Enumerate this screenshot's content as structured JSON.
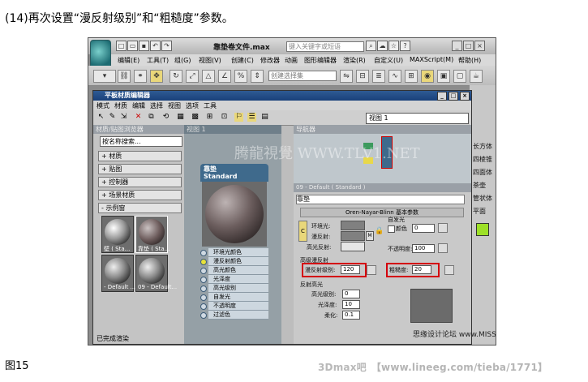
{
  "caption": "(14)再次设置“漫反射级别”和“粗糙度”参数。",
  "figure_label": "图15",
  "footer": {
    "brand": "3Dmax吧",
    "url": "【www.lineeg.com/tieba/1771】"
  },
  "max_window": {
    "doc_title": "靠垫卷文件.max",
    "search_placeholder": "键入关键字或短语",
    "menus": [
      "编辑(E)",
      "工具(T)",
      "组(G)",
      "视图(V)",
      "创建(C)",
      "修改器",
      "动画",
      "图形编辑器",
      "渲染(R)",
      "自定义(U)",
      "MAXScript(M)",
      "帮助(H)"
    ],
    "selection_set": "创建选择集",
    "right_panel": [
      "长方体",
      "四棱锥",
      "四面体",
      "茶壶",
      "管状体",
      "平面"
    ]
  },
  "slate": {
    "title": "平板材质编辑器",
    "menus": [
      "模式",
      "材质",
      "编辑",
      "选择",
      "视图",
      "选项",
      "工具"
    ],
    "view_select": "视图 1",
    "browser": {
      "header": "材质/贴图浏览器",
      "search": "按名称搜索...",
      "categories": [
        "+ 材质",
        "+ 贴图",
        "+ 控制器",
        "+ 场景材质",
        "- 示例窗"
      ],
      "thumbs": [
        "壁 ( Sta...",
        "靠垫 ( Sta...",
        "- Default ...",
        "09 - Default..."
      ]
    },
    "view_tab": "视图 1",
    "node": {
      "name": "靠垫",
      "type": "Standard",
      "slots": [
        "环境光颜色",
        "漫反射颜色",
        "高光颜色",
        "光泽度",
        "高光级别",
        "自发光",
        "不透明度",
        "过滤色"
      ]
    },
    "navigator": "导航器",
    "params": {
      "header": "09 - Default ( Standard )",
      "name": "靠垫",
      "rollout": "Oren-Nayar-Blinn 基本参数",
      "ambient": "环境光:",
      "diffuse": "漫反射:",
      "specular": "高光反射:",
      "self_illum_group": "自发光",
      "color_label": "颜色",
      "color_value": "0",
      "opacity_label": "不透明度:",
      "opacity_value": "100",
      "adv_diffuse": "高级漫反射",
      "diffuse_level_label": "漫反射级别:",
      "diffuse_level_value": "120",
      "roughness_label": "粗糙度:",
      "roughness_value": "20",
      "specular_group": "反射高光",
      "spec_level_label": "高光级别:",
      "spec_level_value": "0",
      "glossiness_label": "光泽度:",
      "glossiness_value": "10",
      "soften_label": "柔化:",
      "soften_value": "0.1"
    },
    "status": "已完成渲染"
  },
  "watermarks": {
    "center": "腾龍視覺 WWW.TLV1.NET",
    "corner": "思缘设计论坛 www.MISSYUAN.COM"
  },
  "colors": {
    "highlight_red": "#d4000d",
    "node_header": "#3f6a8c",
    "title_blue": "#19407a"
  }
}
